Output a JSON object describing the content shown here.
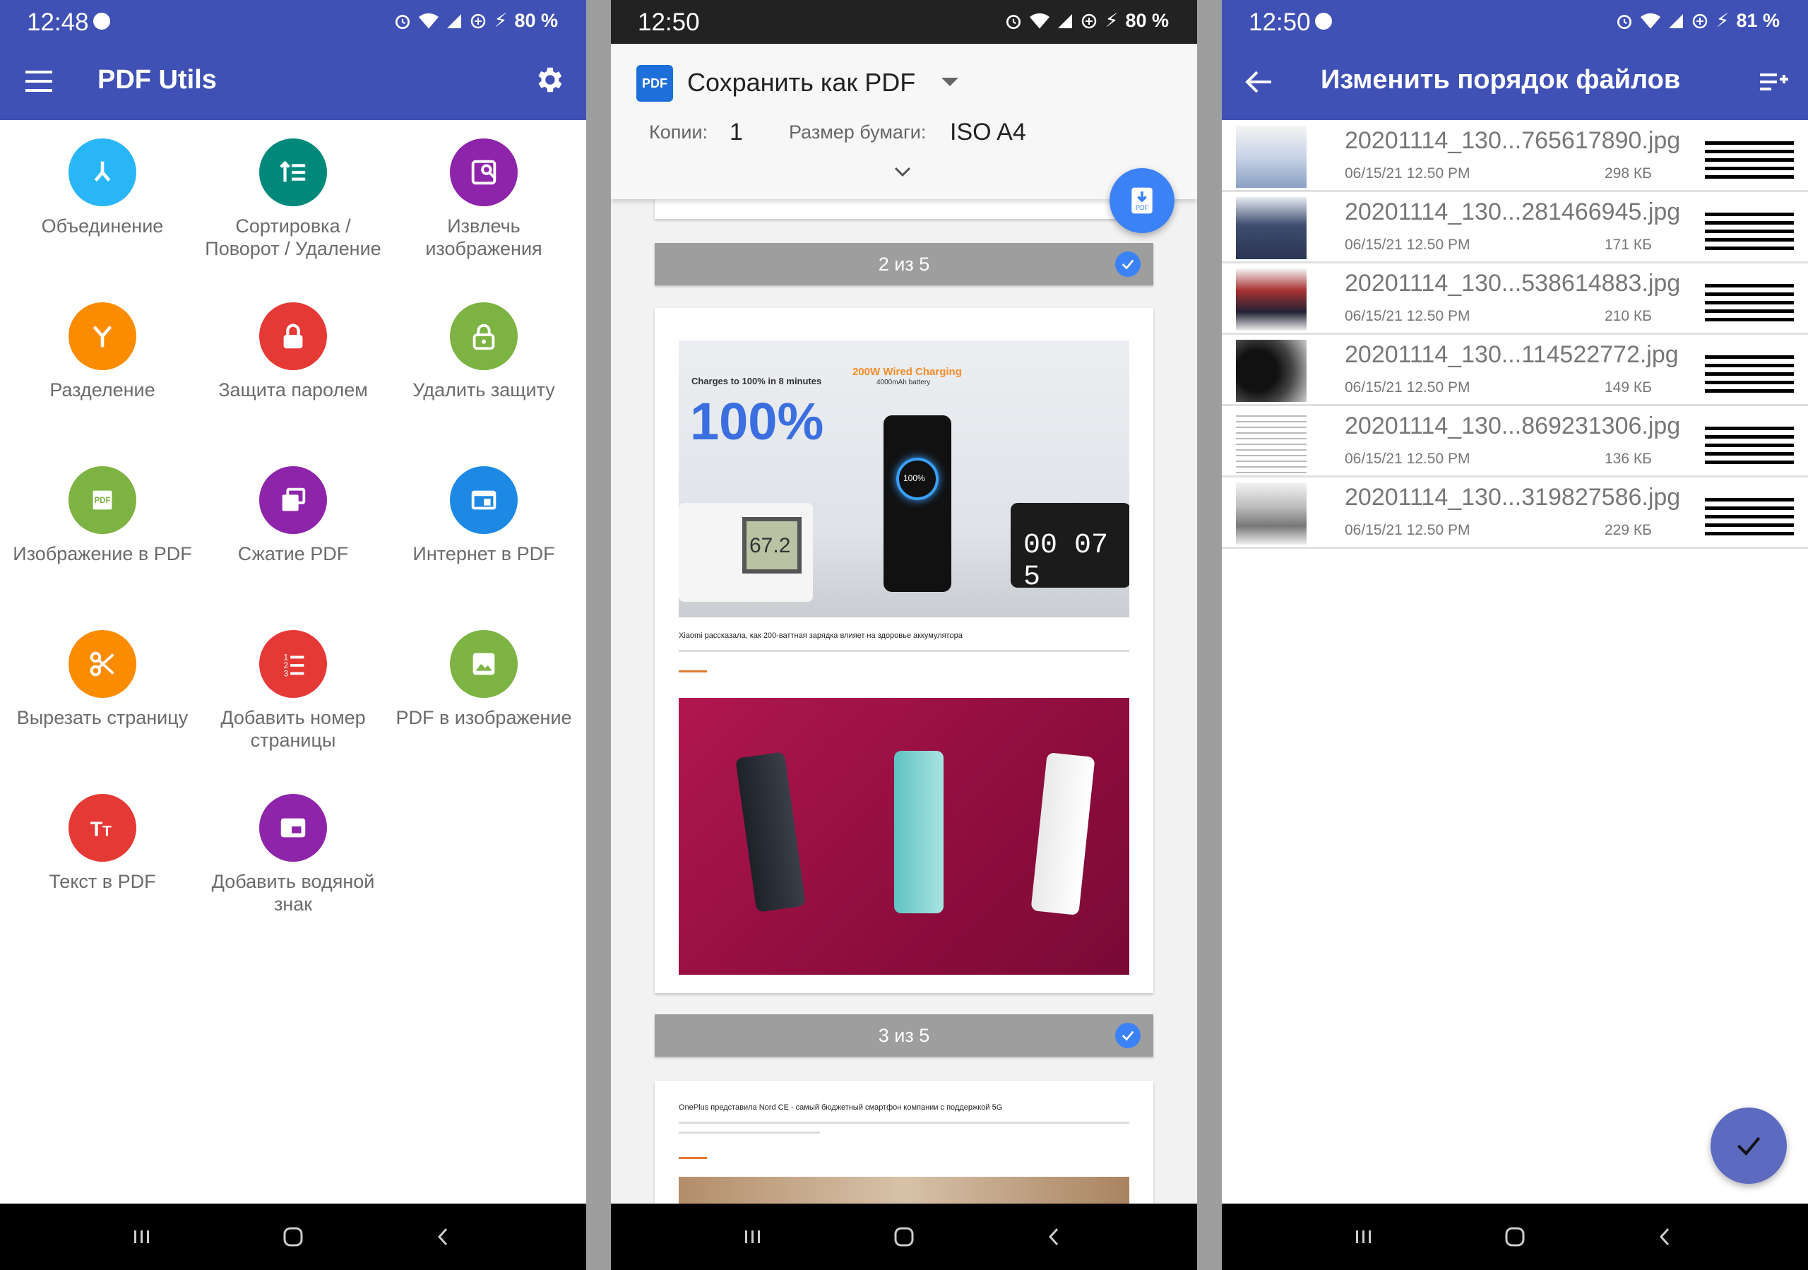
{
  "screens": {
    "home": {
      "status": {
        "time": "12:48",
        "battery": "80 %"
      },
      "title": "PDF Utils",
      "tools": [
        {
          "label": "Объединение",
          "color": "#29b6f6",
          "icon": "merge-icon"
        },
        {
          "label": "Сортировка / Поворот / Удаление",
          "color": "#00897b",
          "icon": "sort-icon"
        },
        {
          "label": "Извлечь изображения",
          "color": "#8e24aa",
          "icon": "extract-images-icon"
        },
        {
          "label": "Разделение",
          "color": "#fb8c00",
          "icon": "split-icon"
        },
        {
          "label": "Защита паролем",
          "color": "#e53935",
          "icon": "lock-icon"
        },
        {
          "label": "Удалить защиту",
          "color": "#7cb342",
          "icon": "unlock-icon"
        },
        {
          "label": "Изображение в PDF",
          "color": "#7cb342",
          "icon": "image-to-pdf-icon"
        },
        {
          "label": "Сжатие PDF",
          "color": "#8e24aa",
          "icon": "compress-icon"
        },
        {
          "label": "Интернет в PDF",
          "color": "#1e88e5",
          "icon": "web-icon"
        },
        {
          "label": "Вырезать страницу",
          "color": "#fb8c00",
          "icon": "scissors-icon"
        },
        {
          "label": "Добавить номер страницы",
          "color": "#e53935",
          "icon": "numbered-list-icon"
        },
        {
          "label": "PDF в изображение",
          "color": "#7cb342",
          "icon": "image-icon"
        },
        {
          "label": "Текст в PDF",
          "color": "#e53935",
          "icon": "text-icon"
        },
        {
          "label": "Добавить водяной знак",
          "color": "#8e24aa",
          "icon": "watermark-icon"
        }
      ]
    },
    "print": {
      "status": {
        "time": "12:50",
        "battery": "80 %"
      },
      "destination": "Сохранить как PDF",
      "copies_label": "Копии:",
      "copies_value": "1",
      "paper_label": "Размер бумаги:",
      "paper_value": "ISO A4",
      "pages": [
        {
          "indicator": "2 из 5"
        },
        {
          "indicator": "3 из 5"
        }
      ],
      "article1": {
        "headline": "Xiaomi рассказала, как 200-ваттная зарядка влияет на здоровье аккумулятора",
        "image_text_a": "Charges to 100% in 8 minutes",
        "image_text_b": "200W Wired Charging",
        "image_text_c": "4000mAh battery",
        "image_big": "100%",
        "clock": "00 07 5",
        "meter": "67.2",
        "phone_value": "100%"
      },
      "article2": {
        "headline": "OnePlus представила Nord CE - самый бюджетный смартфон компании с поддержкой 5G"
      }
    },
    "reorder": {
      "status": {
        "time": "12:50",
        "battery": "81 %"
      },
      "title": "Изменить порядок файлов",
      "files": [
        {
          "name": "20201114_130...765617890.jpg",
          "date": "06/15/21 12.50 PM",
          "size": "298 КБ"
        },
        {
          "name": "20201114_130...281466945.jpg",
          "date": "06/15/21 12.50 PM",
          "size": "171 КБ"
        },
        {
          "name": "20201114_130...538614883.jpg",
          "date": "06/15/21 12.50 PM",
          "size": "210 КБ"
        },
        {
          "name": "20201114_130...114522772.jpg",
          "date": "06/15/21 12.50 PM",
          "size": "149 КБ"
        },
        {
          "name": "20201114_130...869231306.jpg",
          "date": "06/15/21 12.50 PM",
          "size": "136 КБ"
        },
        {
          "name": "20201114_130...319827586.jpg",
          "date": "06/15/21 12.50 PM",
          "size": "229 КБ"
        }
      ]
    }
  }
}
